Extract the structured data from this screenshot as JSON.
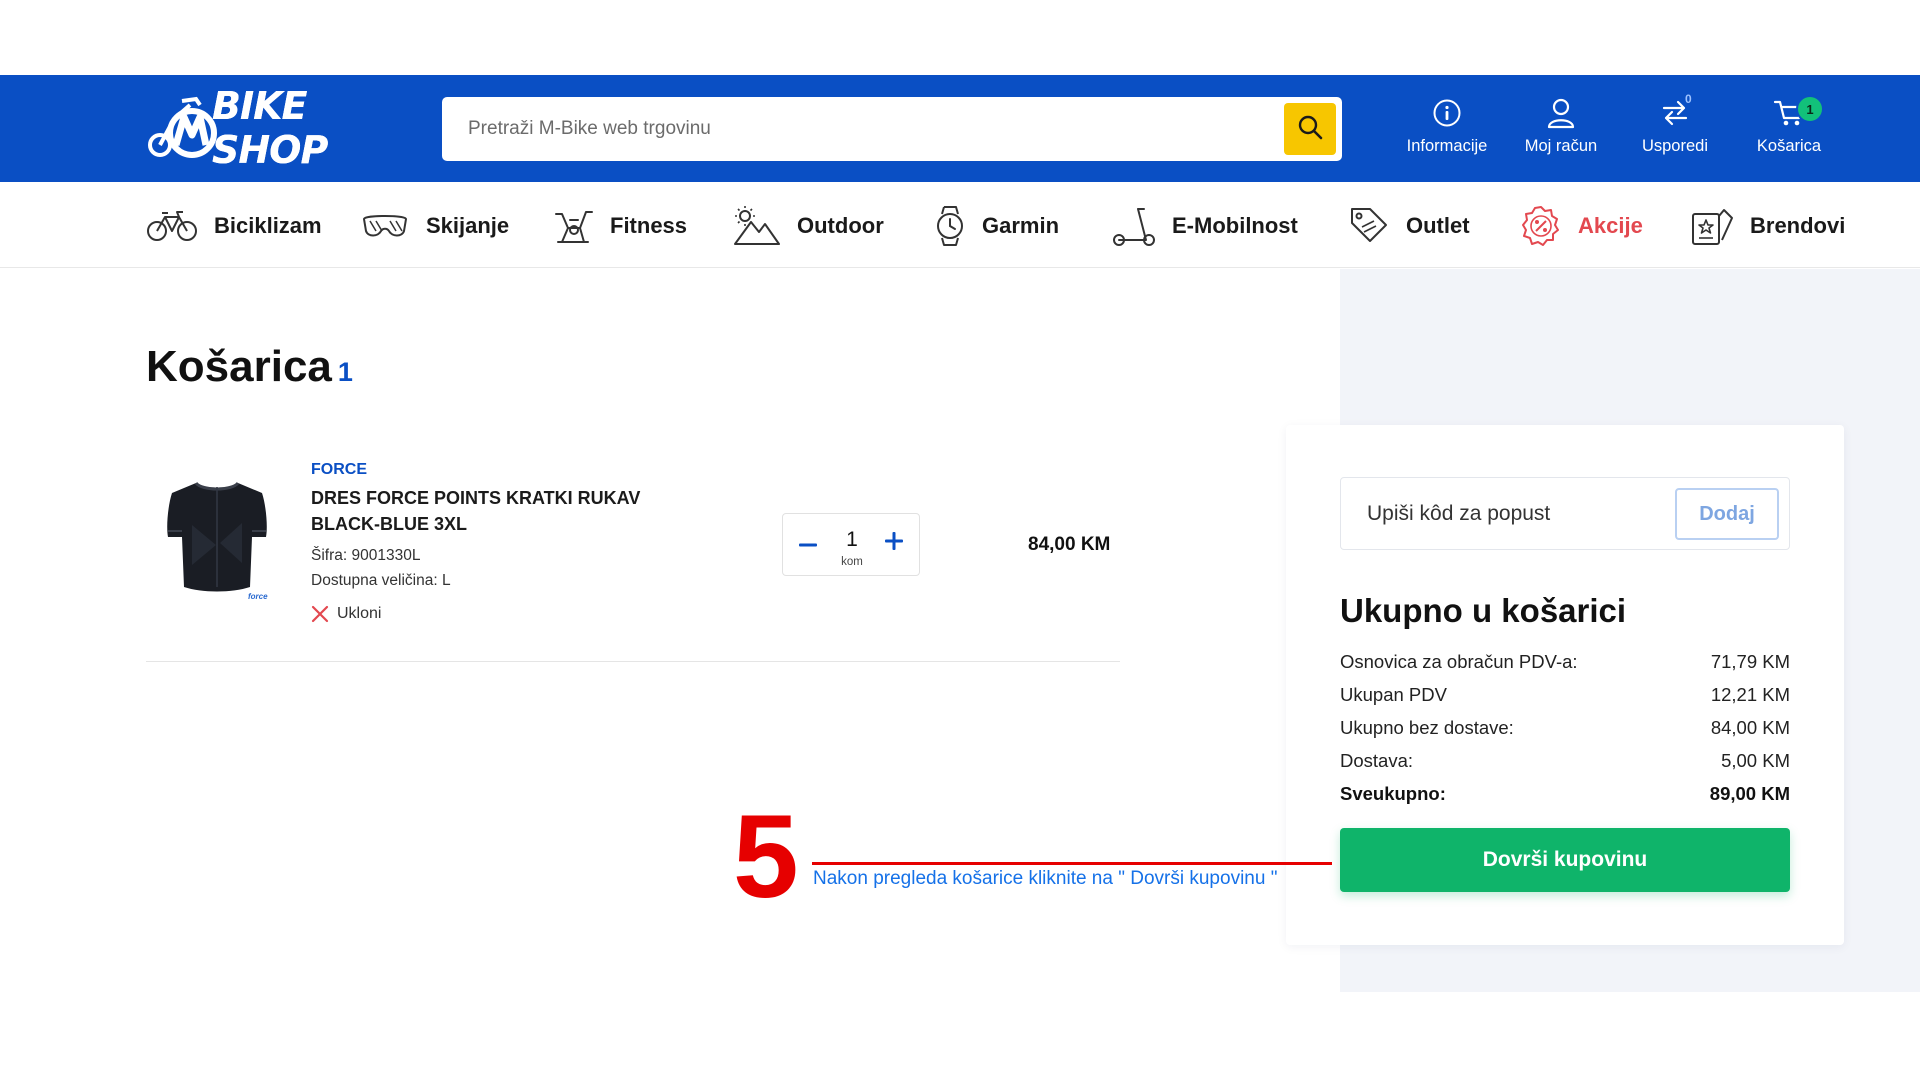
{
  "header": {
    "logo_text": "BIKE SHOP",
    "search_placeholder": "Pretraži M-Bike web trgovinu",
    "items": [
      {
        "label": "Informacije",
        "icon": "info-icon"
      },
      {
        "label": "Moj račun",
        "icon": "user-icon"
      },
      {
        "label": "Usporedi",
        "icon": "compare-icon",
        "badge": "0"
      },
      {
        "label": "Košarica",
        "icon": "cart-icon",
        "badge": "1"
      }
    ]
  },
  "categories": [
    {
      "label": "Biciklizam",
      "icon": "bicycle-icon"
    },
    {
      "label": "Skijanje",
      "icon": "ski-goggles-icon"
    },
    {
      "label": "Fitness",
      "icon": "exercise-bike-icon"
    },
    {
      "label": "Outdoor",
      "icon": "mountain-icon"
    },
    {
      "label": "Garmin",
      "icon": "smartwatch-icon"
    },
    {
      "label": "E-Mobilnost",
      "icon": "scooter-icon"
    },
    {
      "label": "Outlet",
      "icon": "sale-tag-icon"
    },
    {
      "label": "Akcije",
      "icon": "discount-badge-icon"
    },
    {
      "label": "Brendovi",
      "icon": "brand-cards-icon"
    }
  ],
  "cart": {
    "title": "Košarica",
    "count": "1",
    "item": {
      "brand": "FORCE",
      "name": "DRES FORCE POINTS KRATKI RUKAV BLACK-BLUE 3XL",
      "sku": "Šifra: 9001330L",
      "availability": "Dostupna veličina: L",
      "remove_label": "Ukloni",
      "quantity": "1",
      "unit": "kom",
      "price": "84,00 KM"
    }
  },
  "summary": {
    "coupon_placeholder": "Upiši kôd za popust",
    "coupon_button": "Dodaj",
    "title": "Ukupno u košarici",
    "rows": [
      {
        "label": "Osnovica za obračun PDV-a:",
        "value": "71,79 KM"
      },
      {
        "label": "Ukupan PDV",
        "value": "12,21 KM"
      },
      {
        "label": "Ukupno bez dostave:",
        "value": "84,00 KM"
      },
      {
        "label": "Dostava:",
        "value": "5,00 KM"
      },
      {
        "label": "Sveukupno:",
        "value": "89,00 KM"
      }
    ],
    "checkout_label": "Dovrši kupovinu"
  },
  "annotation": {
    "step": "5",
    "note": "Nakon pregleda košarice kliknite na \" Dovrši kupovinu \""
  },
  "colors": {
    "brand_blue": "#0a4fc4",
    "search_yellow": "#f7c600",
    "checkout_green": "#0fb46a",
    "sale_red": "#e3484f",
    "annotation_red": "#e60000",
    "annotation_blue": "#1571e8"
  }
}
